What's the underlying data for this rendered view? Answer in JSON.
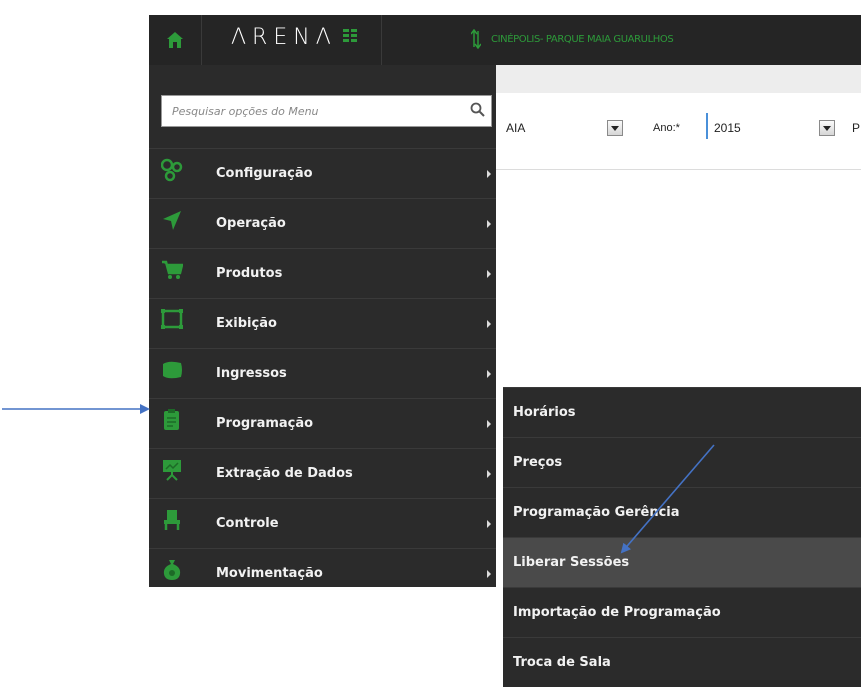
{
  "header": {
    "logo_text": "ΛRENΛ",
    "cinema_name": "CINÉPOLIS- PARQUE MAIA GUARULHOS"
  },
  "filters": {
    "location_value": "AIA",
    "year_label": "Ano:*",
    "year_value": "2015",
    "next_label_partial": "P"
  },
  "search": {
    "placeholder": "Pesquisar opções do Menu"
  },
  "menu": {
    "items": [
      {
        "label": "Configuração",
        "icon": "gears-icon"
      },
      {
        "label": "Operação",
        "icon": "send-icon"
      },
      {
        "label": "Produtos",
        "icon": "cart-icon"
      },
      {
        "label": "Exibição",
        "icon": "screen-icon"
      },
      {
        "label": "Ingressos",
        "icon": "ticket-icon"
      },
      {
        "label": "Programação",
        "icon": "clipboard-icon"
      },
      {
        "label": "Extração de Dados",
        "icon": "presentation-icon"
      },
      {
        "label": "Controle",
        "icon": "chair-icon"
      },
      {
        "label": "Movimentação",
        "icon": "money-bag-icon"
      }
    ]
  },
  "submenu": {
    "items": [
      {
        "label": "Horários"
      },
      {
        "label": "Preços"
      },
      {
        "label": "Programação Gerência"
      },
      {
        "label": "Liberar Sessões"
      },
      {
        "label": "Importação de Programação"
      },
      {
        "label": "Troca de Sala"
      }
    ]
  },
  "colors": {
    "sidebar_bg": "#2b2b2b",
    "topbar_bg": "#252525",
    "accent_green": "#2d9a3a",
    "annotation_arrow": "#4472c4",
    "submenu_active_bg": "#4a4a4a"
  }
}
